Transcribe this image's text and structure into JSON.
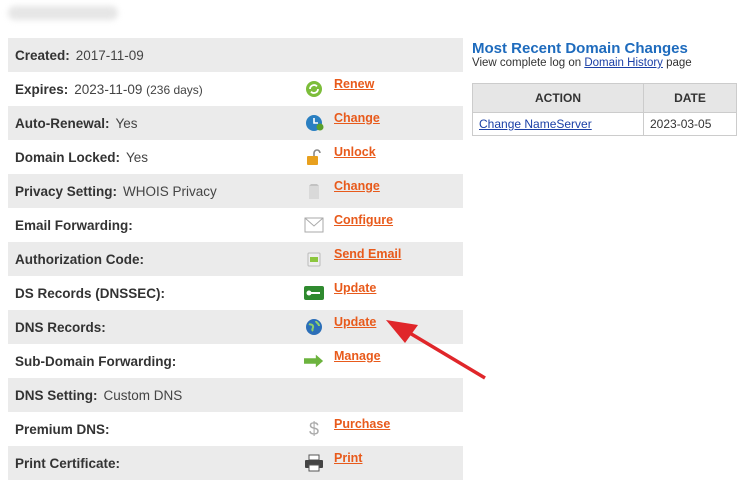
{
  "rows": [
    {
      "label": "Created:",
      "value": "2017-11-09"
    },
    {
      "label": "Expires:",
      "value": "2023-11-09",
      "extra": "(236 days)",
      "action": "Renew",
      "icon": "renew-icon"
    },
    {
      "label": "Auto-Renewal:",
      "value": "Yes",
      "action": "Change",
      "icon": "clock-icon"
    },
    {
      "label": "Domain Locked:",
      "value": "Yes",
      "action": "Unlock",
      "icon": "lock-icon"
    },
    {
      "label": "Privacy Setting:",
      "value": "WHOIS Privacy",
      "action": "Change",
      "icon": "privacy-icon"
    },
    {
      "label": "Email Forwarding:",
      "action": "Configure",
      "icon": "envelope-icon"
    },
    {
      "label": "Authorization Code:",
      "action": "Send Email",
      "icon": "document-icon"
    },
    {
      "label": "DS Records (DNSSEC):",
      "action": "Update",
      "icon": "key-card-icon"
    },
    {
      "label": "DNS Records:",
      "action": "Update",
      "icon": "globe-icon"
    },
    {
      "label": "Sub-Domain Forwarding:",
      "action": "Manage",
      "icon": "arrow-right-icon"
    },
    {
      "label": "DNS Setting:",
      "value": "Custom DNS"
    },
    {
      "label": "Premium DNS:",
      "action": "Purchase",
      "icon": "dollar-icon"
    },
    {
      "label": "Print Certificate:",
      "action": "Print",
      "icon": "printer-icon"
    }
  ],
  "recent": {
    "title": "Most Recent Domain Changes",
    "subtitle_before": "View complete log on ",
    "subtitle_link": "Domain History",
    "subtitle_after": " page",
    "headers": [
      "ACTION",
      "DATE"
    ],
    "rows": [
      {
        "action": "Change NameServer",
        "date": "2023-03-05"
      }
    ]
  },
  "colors": {
    "link": "#e85a1b",
    "title": "#1e6bbd",
    "arrow": "#e0262a"
  }
}
